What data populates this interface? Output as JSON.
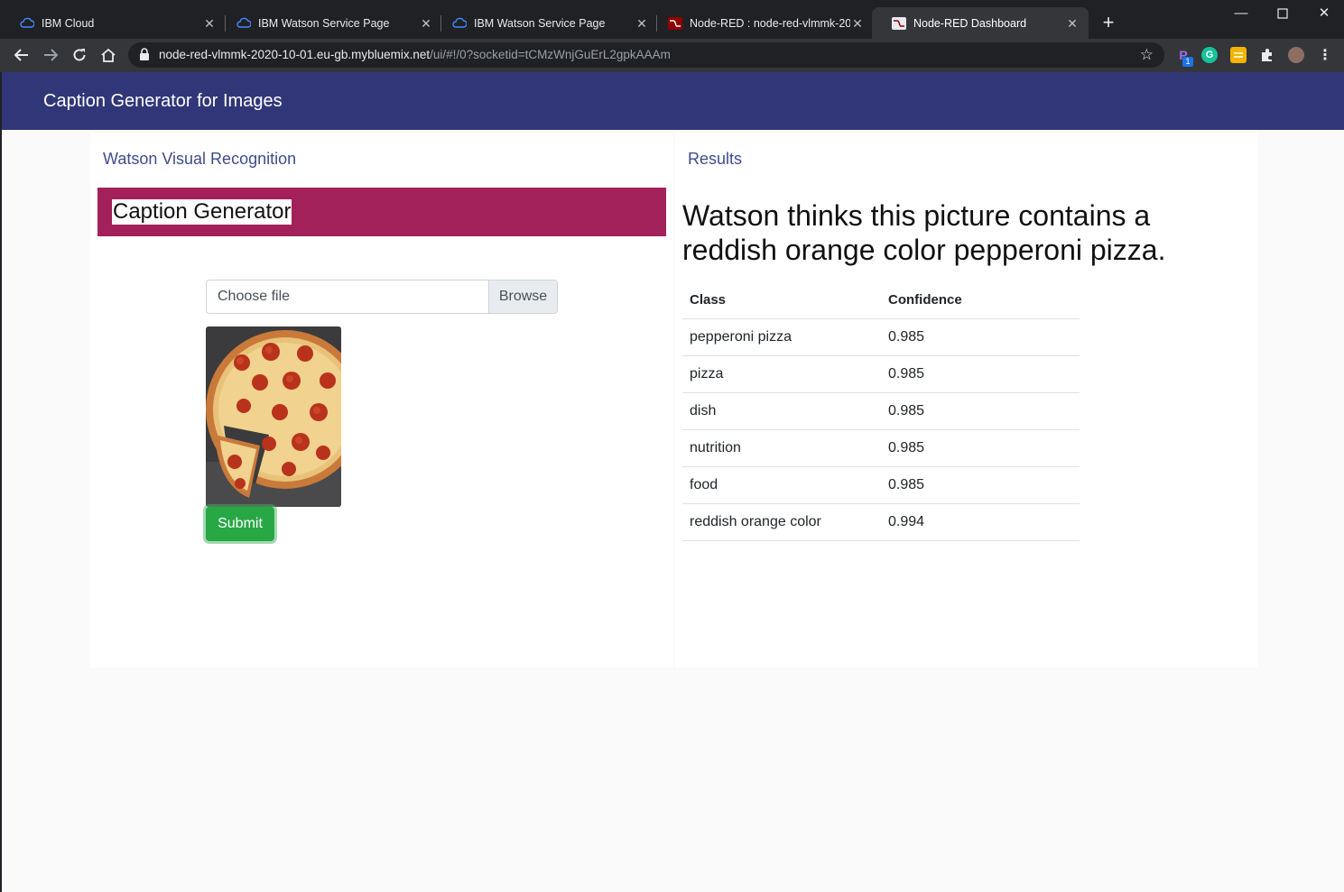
{
  "browser": {
    "tabs": [
      {
        "title": "IBM Cloud",
        "active": false
      },
      {
        "title": "IBM Watson Service Page",
        "active": false
      },
      {
        "title": "IBM Watson Service Page",
        "active": false
      },
      {
        "title": "Node-RED : node-red-vlmmk-20",
        "active": false
      },
      {
        "title": "Node-RED Dashboard",
        "active": true
      }
    ],
    "url_host": "node-red-vlmmk-2020-10-01.eu-gb.mybluemix.net",
    "url_path": "/ui/#!/0?socketid=tCMzWnjGuErL2gpkAAAm",
    "extension_badge": "1"
  },
  "app": {
    "title": "Caption Generator for Images"
  },
  "left_card": {
    "title": "Watson Visual Recognition",
    "banner": "Caption Generator",
    "file_placeholder": "Choose file",
    "browse_label": "Browse",
    "submit_label": "Submit"
  },
  "right_card": {
    "title": "Results",
    "result_sentence": "Watson thinks this picture contains a reddish orange color pepperoni pizza.",
    "table": {
      "headers": [
        "Class",
        "Confidence"
      ],
      "rows": [
        {
          "class": "pepperoni pizza",
          "confidence": "0.985"
        },
        {
          "class": "pizza",
          "confidence": "0.985"
        },
        {
          "class": "dish",
          "confidence": "0.985"
        },
        {
          "class": "nutrition",
          "confidence": "0.985"
        },
        {
          "class": "food",
          "confidence": "0.985"
        },
        {
          "class": "reddish orange color",
          "confidence": "0.994"
        }
      ]
    }
  },
  "colors": {
    "app_bar": "#313678",
    "banner": "#a3215a",
    "card_title": "#3f4b8c",
    "submit": "#28a745"
  }
}
